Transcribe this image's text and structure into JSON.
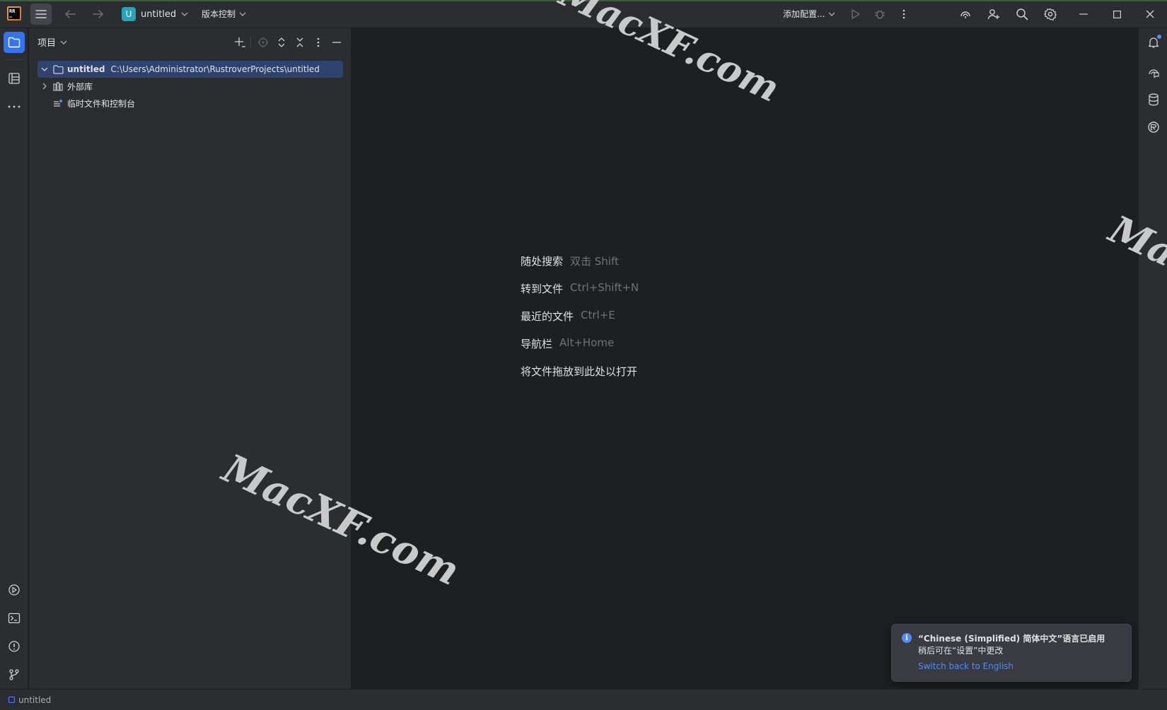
{
  "titlebar": {
    "project_badge": "U",
    "project_name": "untitled",
    "vcs_label": "版本控制",
    "add_config_label": "添加配置..."
  },
  "project_panel": {
    "title": "项目",
    "tree": [
      {
        "name": "untitled",
        "path": "C:\\Users\\Administrator\\RustroverProjects\\untitled",
        "expanded": true,
        "selected": true
      },
      {
        "name": "外部库",
        "expanded": false
      },
      {
        "name": "临时文件和控制台"
      }
    ]
  },
  "editor_hints": [
    {
      "label": "随处搜索",
      "shortcut": "双击 Shift"
    },
    {
      "label": "转到文件",
      "shortcut": "Ctrl+Shift+N"
    },
    {
      "label": "最近的文件",
      "shortcut": "Ctrl+E"
    },
    {
      "label": "导航栏",
      "shortcut": "Alt+Home"
    },
    {
      "label": "将文件拖放到此处以打开",
      "shortcut": ""
    }
  ],
  "notification": {
    "title": "“Chinese (Simplified) 简体中文”语言已启用",
    "body": "稍后可在“设置”中更改",
    "link": "Switch back to English"
  },
  "statusbar": {
    "project": "untitled"
  },
  "watermarks": [
    "MacXF.com",
    "MacXF.com",
    "Ma"
  ],
  "colors": {
    "accent": "#3574f0",
    "link": "#548af7",
    "selection": "#2e436e",
    "project_badge": "#2aa2b7"
  }
}
